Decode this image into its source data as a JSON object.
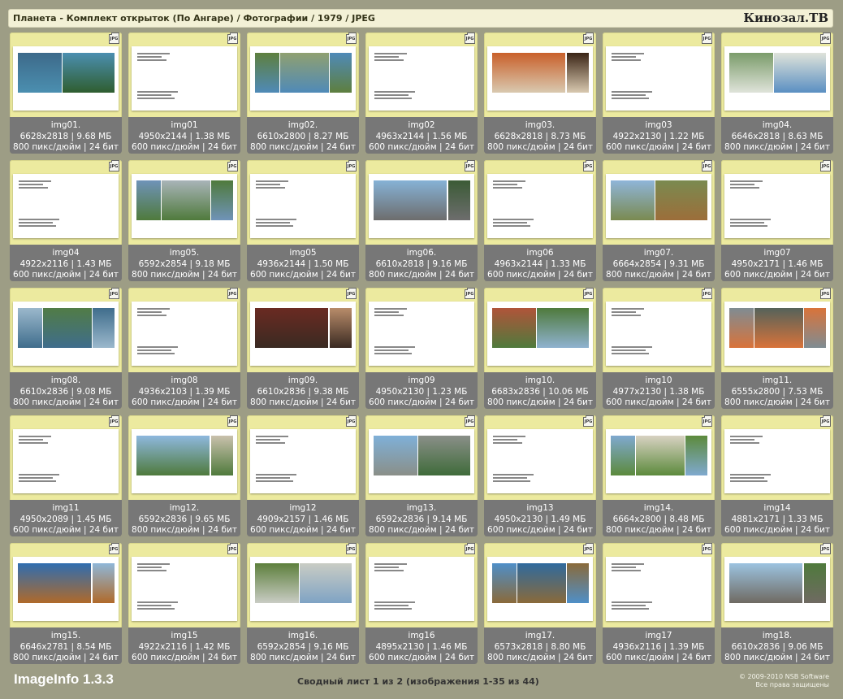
{
  "header": {
    "title": "Планета - Комплект открыток (По Ангаре) / Фотографии / 1979 / JPEG",
    "brand": "Кинозал.ТВ"
  },
  "icon": {
    "name": "jpg-file-icon",
    "label": "JPG"
  },
  "colors": {
    "background": "#9d9d85",
    "cell": "#ecea9f",
    "info_bar": "#777777",
    "title_bar": "#f3f1d6"
  },
  "thumbnails": [
    {
      "name": "img01.",
      "dims": "6628x2818 | 9.68 МБ",
      "res": "800 пикс/дюйм | 24 бит",
      "kind": "photo",
      "palette": [
        "#3d6a8a",
        "#4b8fb0",
        "#2f5e2f"
      ]
    },
    {
      "name": "img01",
      "dims": "4950x2144 | 1.38 МБ",
      "res": "600 пикс/дюйм | 24 бит",
      "kind": "text"
    },
    {
      "name": "img02.",
      "dims": "6610x2800 | 8.27 МБ",
      "res": "800 пикс/дюйм | 24 бит",
      "kind": "photo",
      "palette": [
        "#5e7f3e",
        "#90a070",
        "#4f8ab8"
      ]
    },
    {
      "name": "img02",
      "dims": "4963x2144 | 1.56 МБ",
      "res": "600 пикс/дюйм | 24 бит",
      "kind": "text"
    },
    {
      "name": "img03.",
      "dims": "6628x2818 | 8.73 МБ",
      "res": "800 пикс/дюйм | 24 бит",
      "kind": "photo",
      "palette": [
        "#c9602a",
        "#3a2415",
        "#d9c9b0"
      ]
    },
    {
      "name": "img03",
      "dims": "4922x2130 | 1.22 МБ",
      "res": "600 пикс/дюйм | 24 бит",
      "kind": "text"
    },
    {
      "name": "img04.",
      "dims": "6646x2818 | 8.63 МБ",
      "res": "800 пикс/дюйм | 24 бит",
      "kind": "photo",
      "palette": [
        "#7b9c6a",
        "#dfe3da",
        "#5a8fc2"
      ]
    },
    {
      "name": "img04",
      "dims": "4922x2116 | 1.43 МБ",
      "res": "600 пикс/дюйм | 24 бит",
      "kind": "text"
    },
    {
      "name": "img05.",
      "dims": "6592x2854 | 9.18 МБ",
      "res": "800 пикс/дюйм | 24 бит",
      "kind": "photo",
      "palette": [
        "#6f93b8",
        "#a9b4b8",
        "#4f7a3c"
      ]
    },
    {
      "name": "img05",
      "dims": "4936x2144 | 1.50 МБ",
      "res": "600 пикс/дюйм | 24 бит",
      "kind": "text"
    },
    {
      "name": "img06.",
      "dims": "6610x2818 | 9.16 МБ",
      "res": "800 пикс/дюйм | 24 бит",
      "kind": "photo",
      "palette": [
        "#86b2d6",
        "#3b5b36",
        "#6d6d6d"
      ]
    },
    {
      "name": "img06",
      "dims": "4963x2144 | 1.33 МБ",
      "res": "600 пикс/дюйм | 24 бит",
      "kind": "text"
    },
    {
      "name": "img07.",
      "dims": "6664x2854 | 9.31 МБ",
      "res": "800 пикс/дюйм | 24 бит",
      "kind": "photo",
      "palette": [
        "#8fb5d9",
        "#7a8a50",
        "#9c6e3a"
      ]
    },
    {
      "name": "img07",
      "dims": "4950x2171 | 1.46 МБ",
      "res": "600 пикс/дюйм | 24 бит",
      "kind": "text"
    },
    {
      "name": "img08.",
      "dims": "6610x2836 | 9.08 МБ",
      "res": "800 пикс/дюйм | 24 бит",
      "kind": "photo",
      "palette": [
        "#9bb8cc",
        "#517c46",
        "#3f6d8c"
      ]
    },
    {
      "name": "img08",
      "dims": "4936x2103 | 1.39 МБ",
      "res": "600 пикс/дюйм | 24 бит",
      "kind": "text"
    },
    {
      "name": "img09.",
      "dims": "6610x2836 | 9.38 МБ",
      "res": "800 пикс/дюйм | 24 бит",
      "kind": "photo",
      "palette": [
        "#6a2a22",
        "#b88c6a",
        "#3a2a22"
      ]
    },
    {
      "name": "img09",
      "dims": "4950x2130 | 1.23 МБ",
      "res": "600 пикс/дюйм | 24 бит",
      "kind": "text"
    },
    {
      "name": "img10.",
      "dims": "6683x2836 | 10.06 МБ",
      "res": "800 пикс/дюйм | 24 бит",
      "kind": "photo",
      "palette": [
        "#b0543a",
        "#4f7a3c",
        "#8fb2d0"
      ]
    },
    {
      "name": "img10",
      "dims": "4977x2130 | 1.38 МБ",
      "res": "600 пикс/дюйм | 24 бит",
      "kind": "text"
    },
    {
      "name": "img11.",
      "dims": "6555x2800 | 7.53 МБ",
      "res": "800 пикс/дюйм | 24 бит",
      "kind": "photo",
      "palette": [
        "#7f8c93",
        "#55625a",
        "#d9733a"
      ]
    },
    {
      "name": "img11",
      "dims": "4950x2089 | 1.45 МБ",
      "res": "600 пикс/дюйм | 24 бит",
      "kind": "text"
    },
    {
      "name": "img12.",
      "dims": "6592x2836 | 9.65 МБ",
      "res": "800 пикс/дюйм | 24 бит",
      "kind": "photo",
      "palette": [
        "#8eb8de",
        "#c9c1ac",
        "#4f7a3c"
      ]
    },
    {
      "name": "img12",
      "dims": "4909x2157 | 1.46 МБ",
      "res": "600 пикс/дюйм | 24 бит",
      "kind": "text"
    },
    {
      "name": "img13.",
      "dims": "6592x2836 | 9.14 МБ",
      "res": "800 пикс/дюйм | 24 бит",
      "kind": "photo",
      "palette": [
        "#7fb0d8",
        "#8a8f88",
        "#3f6b3a"
      ]
    },
    {
      "name": "img13",
      "dims": "4950x2130 | 1.49 МБ",
      "res": "600 пикс/дюйм | 24 бит",
      "kind": "text"
    },
    {
      "name": "img14.",
      "dims": "6664x2800 | 8.48 МБ",
      "res": "800 пикс/дюйм | 24 бит",
      "kind": "photo",
      "palette": [
        "#7fa9cf",
        "#d8d2c2",
        "#5c8a3c"
      ]
    },
    {
      "name": "img14",
      "dims": "4881x2171 | 1.33 МБ",
      "res": "600 пикс/дюйм | 24 бит",
      "kind": "text"
    },
    {
      "name": "img15.",
      "dims": "6646x2781 | 8.54 МБ",
      "res": "800 пикс/дюйм | 24 бит",
      "kind": "photo",
      "palette": [
        "#2f6db0",
        "#8fb7d8",
        "#b06a2a"
      ]
    },
    {
      "name": "img15",
      "dims": "4922x2116 | 1.42 МБ",
      "res": "600 пикс/дюйм | 24 бит",
      "kind": "text"
    },
    {
      "name": "img16.",
      "dims": "6592x2854 | 9.16 МБ",
      "res": "800 пикс/дюйм | 24 бит",
      "kind": "photo",
      "palette": [
        "#5d7f3c",
        "#c9ccc4",
        "#7fa3c4"
      ]
    },
    {
      "name": "img16",
      "dims": "4895x2130 | 1.46 МБ",
      "res": "600 пикс/дюйм | 24 бит",
      "kind": "text"
    },
    {
      "name": "img17.",
      "dims": "6573x2818 | 8.80 МБ",
      "res": "800 пикс/дюйм | 24 бит",
      "kind": "photo",
      "palette": [
        "#4f8fc8",
        "#2f6a9e",
        "#8a6a3a"
      ]
    },
    {
      "name": "img17",
      "dims": "4936x2116 | 1.39 МБ",
      "res": "600 пикс/дюйм | 24 бит",
      "kind": "text"
    },
    {
      "name": "img18.",
      "dims": "6610x2836 | 9.06 МБ",
      "res": "800 пикс/дюйм | 24 бит",
      "kind": "photo",
      "palette": [
        "#9cc3e0",
        "#4f7a3c",
        "#6f6a62"
      ]
    }
  ],
  "footer": {
    "app_name": "ImageInfo 1.3.3",
    "sheet": "Сводный лист 1 из 2 (изображения 1-35 из 44)",
    "copyright": "© 2009-2010 NSB Software",
    "rights": "Все права защищены"
  }
}
